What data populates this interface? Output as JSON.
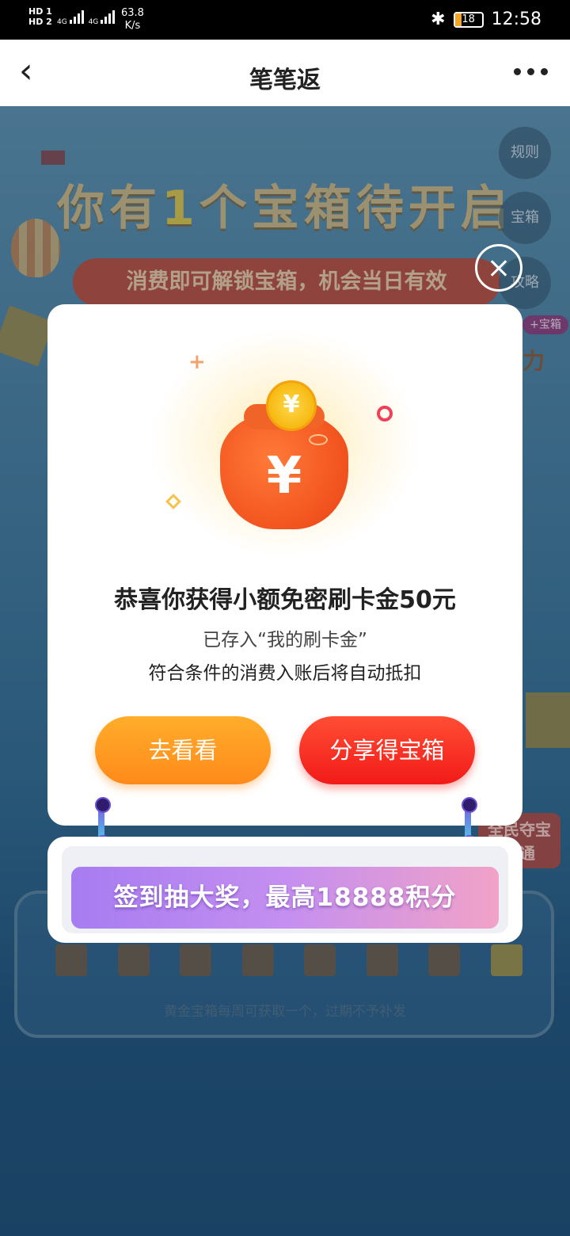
{
  "status_bar": {
    "network_left": "HD 1\nHD 2",
    "signal1_label": "4G",
    "signal2_label": "4G",
    "speed_value": "63.8",
    "speed_unit": "K/s",
    "bluetooth_icon": "bluetooth-icon",
    "battery_level": "18",
    "time": "12:58"
  },
  "nav": {
    "back_icon": "chevron-left-icon",
    "title": "笔笔返",
    "more_icon": "more-dots-icon"
  },
  "background": {
    "headline_pre": "你有",
    "headline_num": "1",
    "headline_post": "个宝箱待开启",
    "subpill": "消费即可解锁宝箱，机会当日有效",
    "side_buttons": [
      "规则",
      "宝箱",
      "攻略"
    ],
    "side_tag": "+宝箱",
    "side_fragment": "力",
    "right_promo": "全民夺宝\n直通",
    "board_note": "黄金宝箱每周可获取一个，过期不予补发"
  },
  "modal": {
    "close_icon": "close-icon",
    "coin_symbol": "¥",
    "bag_symbol": "¥",
    "title": "恭喜你获得小额免密刷卡金50元",
    "line1": "已存入“我的刷卡金”",
    "line2": "符合条件的消费入账后将自动抵扣",
    "btn_look": "去看看",
    "btn_share": "分享得宝箱"
  },
  "banner": {
    "text": "签到抽大奖，最高18888积分"
  },
  "colors": {
    "accent_orange": "#ff9a22",
    "accent_red": "#f5281d",
    "banner_purple": "#b486f0"
  }
}
